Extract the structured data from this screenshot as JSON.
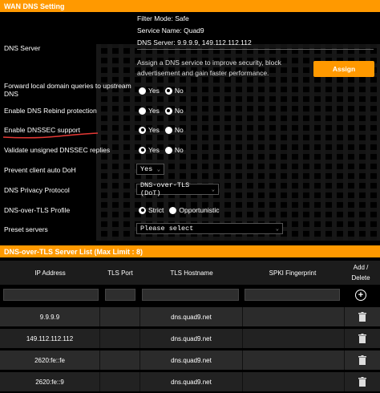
{
  "section_title": "WAN DNS Setting",
  "dns_server": {
    "label": "DNS Server",
    "filter_mode": "Filter Mode: Safe",
    "service_name": "Service Name: Quad9",
    "dns_server_value": "DNS Server: 9.9.9.9, 149.112.112.112",
    "assign_desc": "Assign a DNS service to improve security, block advertisement and gain faster performance.",
    "assign_button": "Assign"
  },
  "settings": [
    {
      "label": "Forward local domain queries to upstream DNS",
      "options": [
        "Yes",
        "No"
      ],
      "selected": "No"
    },
    {
      "label": "Enable DNS Rebind protection",
      "options": [
        "Yes",
        "No"
      ],
      "selected": "No"
    },
    {
      "label": "Enable DNSSEC support",
      "options": [
        "Yes",
        "No"
      ],
      "selected": "Yes"
    },
    {
      "label": "Validate unsigned DNSSEC replies",
      "options": [
        "Yes",
        "No"
      ],
      "selected": "Yes"
    }
  ],
  "prevent_doh": {
    "label": "Prevent client auto DoH",
    "value": "Yes"
  },
  "privacy_protocol": {
    "label": "DNS Privacy Protocol",
    "value": "DNS-over-TLS (DoT)"
  },
  "dot_profile": {
    "label": "DNS-over-TLS Profile",
    "options": [
      "Strict",
      "Opportunistic"
    ],
    "selected": "Strict"
  },
  "preset_servers": {
    "label": "Preset servers",
    "value": "Please select"
  },
  "server_list": {
    "title": "DNS-over-TLS Server List (Max Limit : 8)",
    "columns": [
      "IP Address",
      "TLS Port",
      "TLS Hostname",
      "SPKI Fingerprint",
      "Add / Delete"
    ],
    "rows": [
      {
        "ip": "9.9.9.9",
        "port": "",
        "hostname": "dns.quad9.net",
        "spki": ""
      },
      {
        "ip": "149.112.112.112",
        "port": "",
        "hostname": "dns.quad9.net",
        "spki": ""
      },
      {
        "ip": "2620:fe::fe",
        "port": "",
        "hostname": "dns.quad9.net",
        "spki": ""
      },
      {
        "ip": "2620:fe::9",
        "port": "",
        "hostname": "dns.quad9.net",
        "spki": ""
      }
    ]
  },
  "colors": {
    "accent": "#ff9900",
    "annotation_underline": "#e53935"
  }
}
